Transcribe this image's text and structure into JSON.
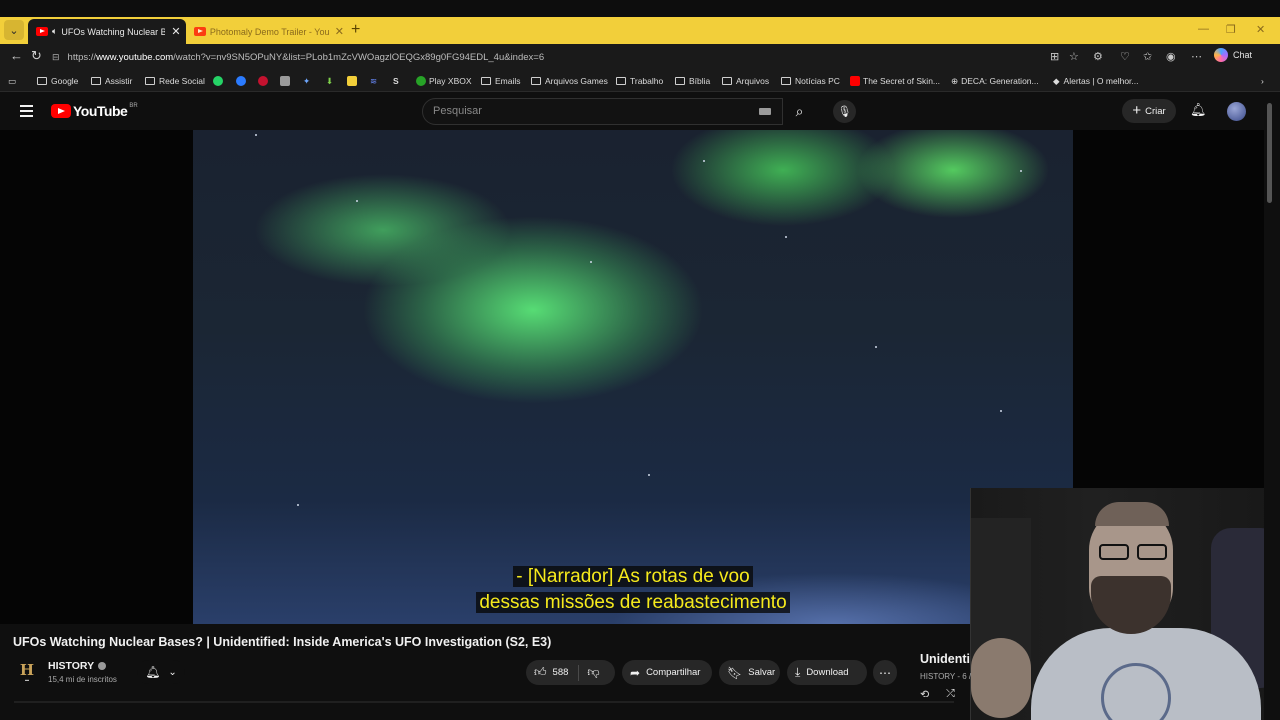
{
  "browser": {
    "tabs": [
      {
        "title": "UFOs Watching Nuclear Bases",
        "active": true
      },
      {
        "title": "Photomaly Demo Trailer - YouTube",
        "active": false
      }
    ],
    "url_prefix": "https://",
    "url_host": "www.youtube.com",
    "url_path": "/watch?v=nv9SN5OPuNY&list=PLob1mZcVWOagzlOEQGx89g0FG94EDL_4u&index=6",
    "chat_label": "Chat",
    "bookmarks": [
      "Google",
      "Assistir",
      "Rede Social",
      "Play XBOX",
      "Emails",
      "Arquivos Games",
      "Trabalho",
      "Bíblia",
      "Arquivos",
      "Notícias PC",
      "The Secret of Skin...",
      "DECA: Generation...",
      "Alertas | O melhor..."
    ]
  },
  "youtube": {
    "logo_text": "YouTube",
    "region": "BR",
    "search_placeholder": "Pesquisar",
    "create_label": "Criar"
  },
  "video": {
    "subtitle_line1": "- [Narrador] As rotas de voo",
    "subtitle_line2": "dessas missões de reabastecimento",
    "title": "UFOs Watching Nuclear Bases? | Unidentified: Inside America's UFO Investigation (S2, E3)",
    "channel": "HISTORY",
    "subscribers": "15,4 mi de inscritos",
    "likes": "588",
    "share_label": "Compartilhar",
    "save_label": "Salvar",
    "download_label": "Download"
  },
  "playlist": {
    "title": "Unidenti",
    "subtitle": "HISTORY - 6 /"
  },
  "colors": {
    "chrome_accent": "#f2cf3a",
    "youtube_red": "#ff0000",
    "subtitle_yellow": "#f6ea1c",
    "background": "#0f0f0f"
  }
}
